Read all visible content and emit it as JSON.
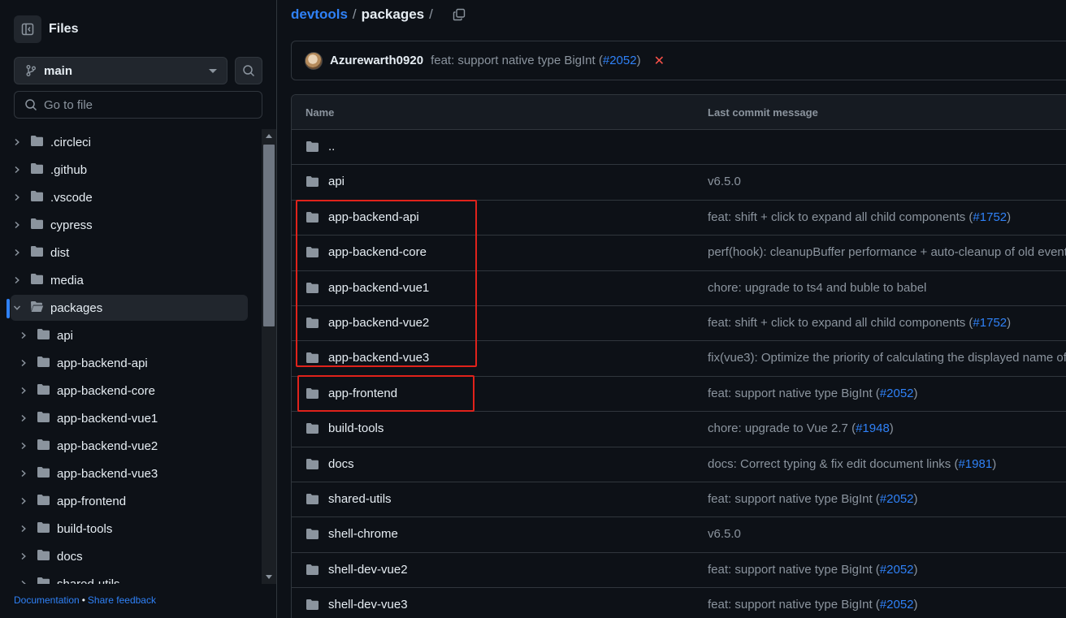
{
  "sidebar": {
    "title": "Files",
    "branch": "main",
    "goto_placeholder": "Go to file",
    "tree": [
      {
        "name": ".circleci",
        "expanded": false,
        "indent": 0
      },
      {
        "name": ".github",
        "expanded": false,
        "indent": 0
      },
      {
        "name": ".vscode",
        "expanded": false,
        "indent": 0
      },
      {
        "name": "cypress",
        "expanded": false,
        "indent": 0
      },
      {
        "name": "dist",
        "expanded": false,
        "indent": 0
      },
      {
        "name": "media",
        "expanded": false,
        "indent": 0
      },
      {
        "name": "packages",
        "expanded": true,
        "indent": 0,
        "active": true
      },
      {
        "name": "api",
        "expanded": false,
        "indent": 1
      },
      {
        "name": "app-backend-api",
        "expanded": false,
        "indent": 1
      },
      {
        "name": "app-backend-core",
        "expanded": false,
        "indent": 1
      },
      {
        "name": "app-backend-vue1",
        "expanded": false,
        "indent": 1
      },
      {
        "name": "app-backend-vue2",
        "expanded": false,
        "indent": 1
      },
      {
        "name": "app-backend-vue3",
        "expanded": false,
        "indent": 1
      },
      {
        "name": "app-frontend",
        "expanded": false,
        "indent": 1
      },
      {
        "name": "build-tools",
        "expanded": false,
        "indent": 1
      },
      {
        "name": "docs",
        "expanded": false,
        "indent": 1
      },
      {
        "name": "shared-utils",
        "expanded": false,
        "indent": 1
      }
    ],
    "footer": {
      "documentation": "Documentation",
      "separator": "•",
      "feedback": "Share feedback"
    }
  },
  "breadcrumb": {
    "repo": "devtools",
    "sep": "/",
    "current": "packages"
  },
  "latest_commit": {
    "author": "Azurewarth0920",
    "message": "feat: support native type BigInt (",
    "pr": "#2052",
    "close": ")",
    "status_icon": "x"
  },
  "table": {
    "headers": {
      "name": "Name",
      "message": "Last commit message"
    },
    "rows": [
      {
        "name": "..",
        "msg": "",
        "pr": "",
        "tail": ""
      },
      {
        "name": "api",
        "msg": "v6.5.0",
        "pr": "",
        "tail": ""
      },
      {
        "name": "app-backend-api",
        "msg": "feat: shift + click to expand all child components (",
        "pr": "#1752",
        "tail": ")"
      },
      {
        "name": "app-backend-core",
        "msg": "perf(hook): cleanupBuffer performance + auto-cleanup of old events",
        "pr": "",
        "tail": ""
      },
      {
        "name": "app-backend-vue1",
        "msg": "chore: upgrade to ts4 and buble to babel",
        "pr": "",
        "tail": ""
      },
      {
        "name": "app-backend-vue2",
        "msg": "feat: shift + click to expand all child components (",
        "pr": "#1752",
        "tail": ")"
      },
      {
        "name": "app-backend-vue3",
        "msg": "fix(vue3): Optimize the priority of calculating the displayed name of",
        "pr": "",
        "tail": ""
      },
      {
        "name": "app-frontend",
        "msg": "feat: support native type BigInt (",
        "pr": "#2052",
        "tail": ")"
      },
      {
        "name": "build-tools",
        "msg": "chore: upgrade to Vue 2.7 (",
        "pr": "#1948",
        "tail": ")"
      },
      {
        "name": "docs",
        "msg": "docs: Correct typing & fix edit document links (",
        "pr": "#1981",
        "tail": ")"
      },
      {
        "name": "shared-utils",
        "msg": "feat: support native type BigInt (",
        "pr": "#2052",
        "tail": ")"
      },
      {
        "name": "shell-chrome",
        "msg": "v6.5.0",
        "pr": "",
        "tail": ""
      },
      {
        "name": "shell-dev-vue2",
        "msg": "feat: support native type BigInt (",
        "pr": "#2052",
        "tail": ")"
      },
      {
        "name": "shell-dev-vue3",
        "msg": "feat: support native type BigInt (",
        "pr": "#2052",
        "tail": ")"
      }
    ]
  },
  "colors": {
    "accent": "#2f81f7",
    "highlight_box": "#e0221b",
    "fail": "#f85149"
  }
}
